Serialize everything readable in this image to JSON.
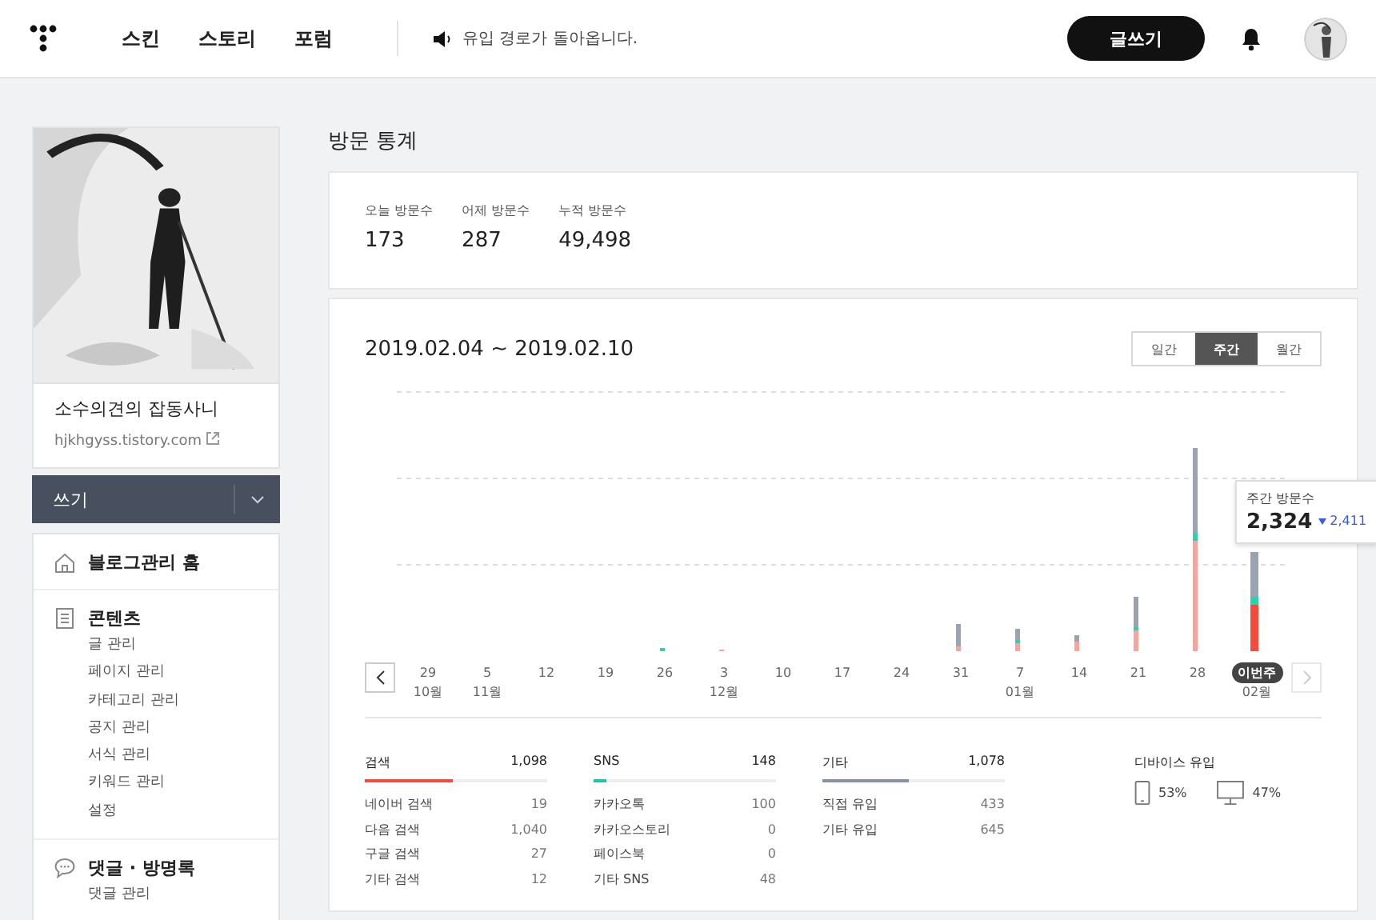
{
  "top_nav": {
    "items": [
      "스킨",
      "스토리",
      "포럼"
    ],
    "notice": "유입 경로가 돌아옵니다.",
    "write_button": "글쓰기"
  },
  "sidebar": {
    "blog_name": "소수의견의 잡동사니",
    "blog_url": "hjkhgyss.tistory.com",
    "write_button": "쓰기",
    "menu": [
      {
        "kind": "home",
        "label": "블로그관리 홈"
      },
      {
        "kind": "document",
        "label": "콘텐츠",
        "children": [
          "글 관리",
          "페이지 관리",
          "카테고리 관리",
          "공지 관리",
          "서식 관리",
          "키워드 관리",
          "설정"
        ]
      },
      {
        "kind": "comment",
        "label": "댓글 · 방명록",
        "children": [
          "댓글 관리"
        ]
      }
    ]
  },
  "page_title": "방문 통계",
  "stats": [
    {
      "label": "오늘 방문수",
      "value": "173"
    },
    {
      "label": "어제 방문수",
      "value": "287"
    },
    {
      "label": "누적 방문수",
      "value": "49,498"
    }
  ],
  "period": {
    "range": "2019.02.04 ~ 2019.02.10",
    "tabs": [
      {
        "label": "일간",
        "selected": false
      },
      {
        "label": "주간",
        "selected": true
      },
      {
        "label": "월간",
        "selected": false
      }
    ]
  },
  "chart": {
    "weeks": [
      {
        "day": "29",
        "month": "10월",
        "current": false
      },
      {
        "day": "5",
        "month": "11월",
        "current": false
      },
      {
        "day": "12",
        "current": false
      },
      {
        "day": "19",
        "current": false
      },
      {
        "day": "26",
        "current": false
      },
      {
        "day": "3",
        "month": "12월",
        "current": false
      },
      {
        "day": "10",
        "current": false
      },
      {
        "day": "17",
        "current": false
      },
      {
        "day": "24",
        "current": false
      },
      {
        "day": "31",
        "current": false
      },
      {
        "day": "7",
        "month": "01월",
        "current": false
      },
      {
        "day": "14",
        "current": false
      },
      {
        "day": "21",
        "current": false
      },
      {
        "day": "28",
        "current": false
      },
      {
        "day": "이번주",
        "month": "02월",
        "current": true
      }
    ],
    "tooltip": {
      "label": "주간 방문수",
      "value": "2,324",
      "previous": "2,411"
    }
  },
  "sources": [
    {
      "title": "검색",
      "total": "1,098",
      "level": 0.48,
      "color": "#f44b3c",
      "items": [
        {
          "label": "네이버 검색",
          "value": "19"
        },
        {
          "label": "다음 검색",
          "value": "1,040"
        },
        {
          "label": "구글 검색",
          "value": "27"
        },
        {
          "label": "기타 검색",
          "value": "12"
        }
      ]
    },
    {
      "title": "SNS",
      "total": "148",
      "level": 0.07,
      "color": "#20c4a4",
      "items": [
        {
          "label": "카카오톡",
          "value": "100"
        },
        {
          "label": "카카오스토리",
          "value": "0"
        },
        {
          "label": "페이스북",
          "value": "0"
        },
        {
          "label": "기타 SNS",
          "value": "48"
        }
      ]
    },
    {
      "title": "기타",
      "total": "1,078",
      "level": 0.47,
      "color": "#8891a6",
      "items": [
        {
          "label": "직접 유입",
          "value": "433"
        },
        {
          "label": "기타 유입",
          "value": "645"
        }
      ]
    }
  ],
  "devices": {
    "title": "디바이스 유입",
    "items": [
      {
        "kind": "mobile",
        "share": "53%"
      },
      {
        "kind": "desktop",
        "share": "47%"
      }
    ]
  }
}
